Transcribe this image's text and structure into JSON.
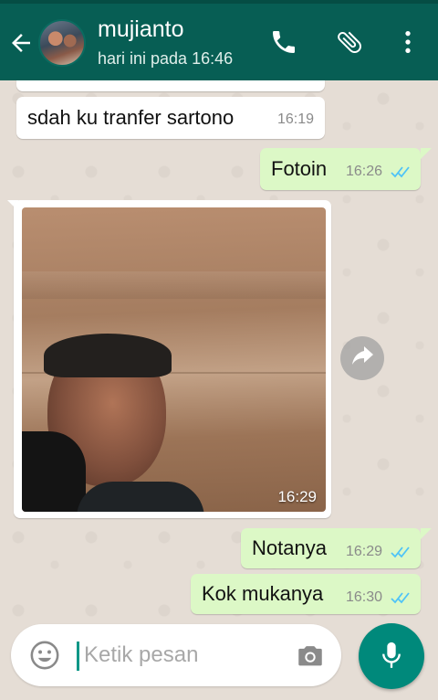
{
  "header": {
    "contact_name": "mujianto",
    "last_seen": "hari ini pada 16:46",
    "back_icon": "arrow-back-icon",
    "call_icon": "phone-icon",
    "attach_icon": "paperclip-icon",
    "menu_icon": "more-vert-icon",
    "color": "#075e54"
  },
  "messages": [
    {
      "direction": "in",
      "text": "sdah ku tranfer sartono",
      "time": "16:19"
    },
    {
      "direction": "out",
      "text": "Fotoin",
      "time": "16:26",
      "status": "read"
    },
    {
      "direction": "in",
      "type": "image",
      "time": "16:29"
    },
    {
      "direction": "out",
      "text": "Notanya",
      "time": "16:29",
      "status": "read"
    },
    {
      "direction": "out",
      "text": "Kok mukanya",
      "time": "16:30",
      "status": "read"
    }
  ],
  "composer": {
    "placeholder": "Ketik pesan",
    "emoji_icon": "emoji-icon",
    "camera_icon": "camera-icon",
    "mic_icon": "mic-icon"
  },
  "colors": {
    "outgoing_bubble": "#dcf8c6",
    "incoming_bubble": "#ffffff",
    "read_ticks": "#4fc3f7",
    "accent": "#00897b"
  }
}
